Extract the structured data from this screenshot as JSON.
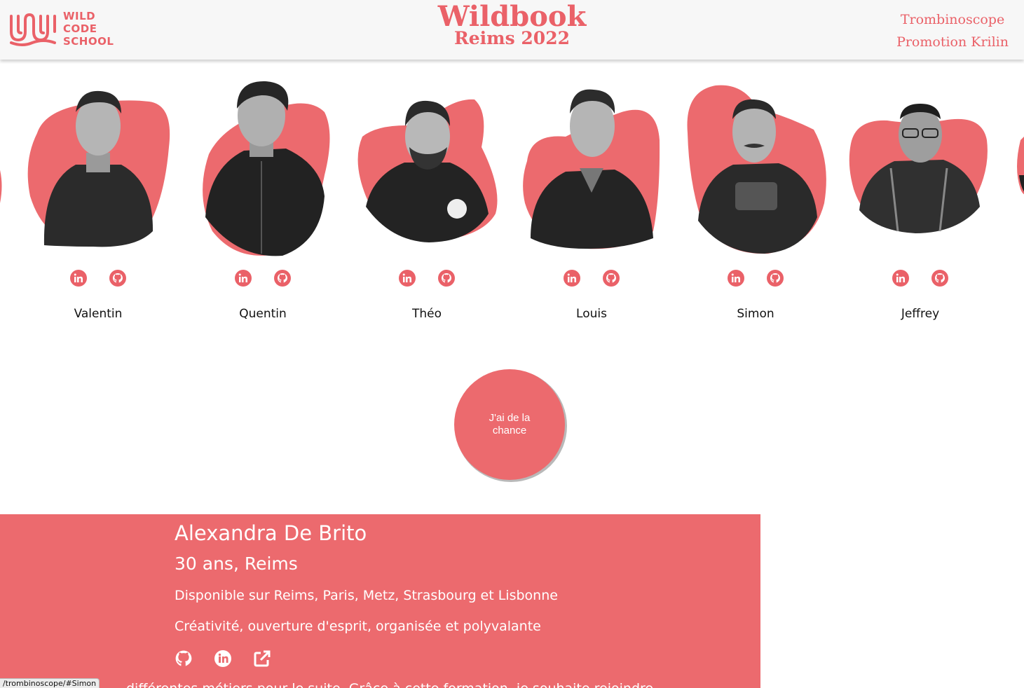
{
  "header": {
    "logo_lines": [
      "WILD",
      "CODE",
      "SCHOOL"
    ],
    "title": "Wildbook",
    "subtitle": "Reims 2022",
    "nav": [
      "Trombinoscope",
      "Promotion Krilin"
    ]
  },
  "members": [
    {
      "name": "Valentin"
    },
    {
      "name": "Quentin"
    },
    {
      "name": "Théo"
    },
    {
      "name": "Louis"
    },
    {
      "name": "Simon"
    },
    {
      "name": "Jeffrey"
    }
  ],
  "luck_button": "J'ai de la chance",
  "profile": {
    "name": "Alexandra De Brito",
    "age_city": "30 ans, Reims",
    "availability": "Disponible sur Reims, Paris, Metz, Strasbourg et Lisbonne",
    "qualities": "Créativité, ouverture d'esprit, organisée et polyvalante",
    "description_partial": "différentes métiers pour le suite. Grâce à cette formation, je souhaite rejoindre"
  },
  "status_url": "/trombinoscope/#Simon",
  "colors": {
    "accent": "#ea6168",
    "panel": "#ec6a6e",
    "header_bg": "#f7f7f7"
  },
  "icons": [
    "linkedin-icon",
    "github-icon",
    "external-link-icon"
  ]
}
